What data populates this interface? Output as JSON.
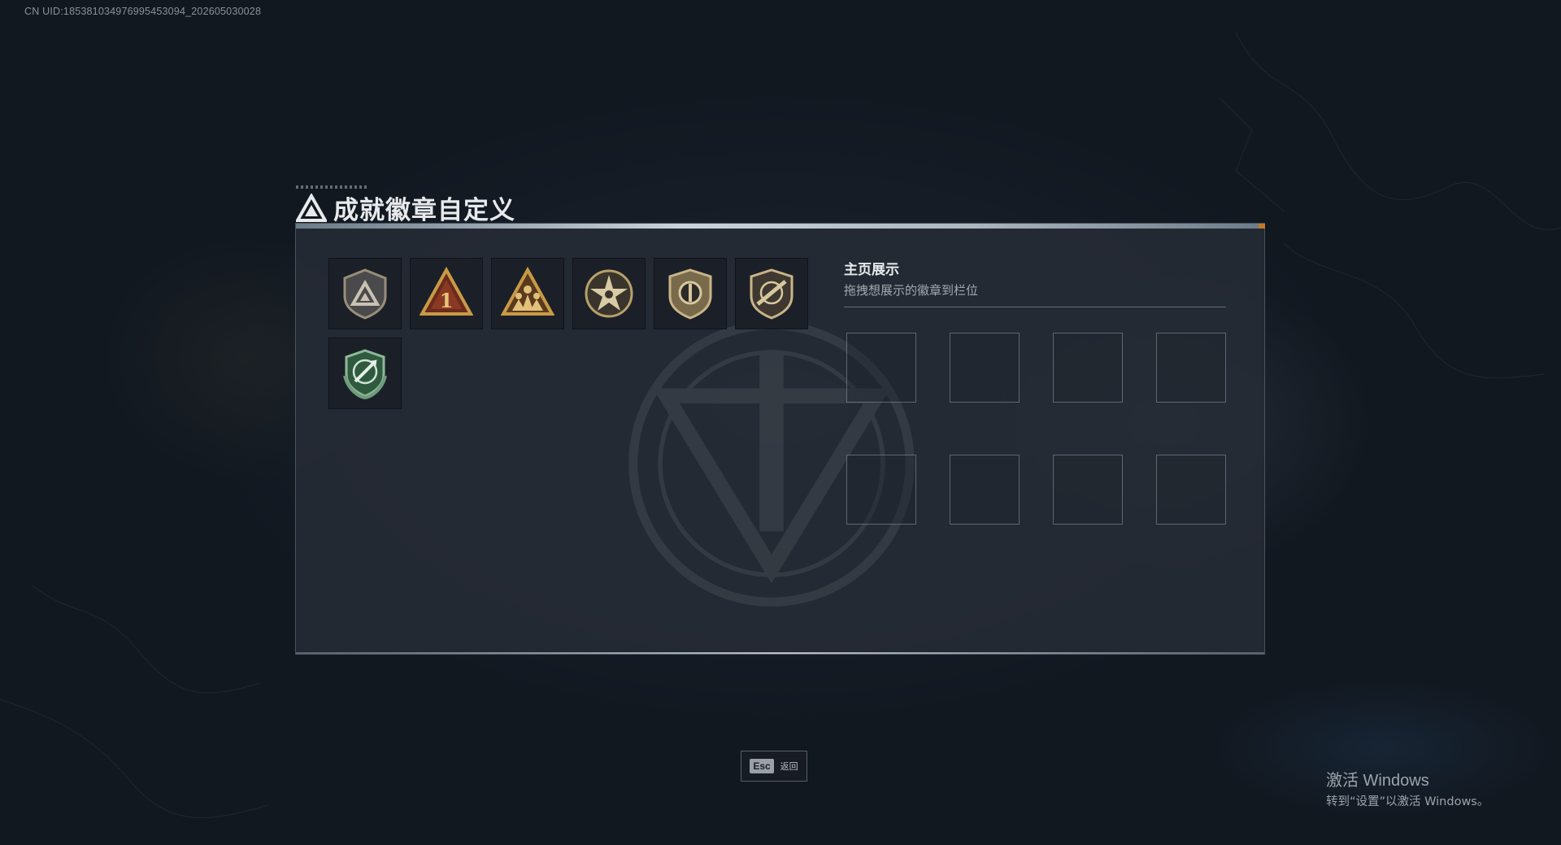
{
  "uid_text": "CN UID:1853810349769954530​94_202605030028",
  "header": {
    "title": "成就徽章自定义",
    "logo_icon": "triangle-logo-icon"
  },
  "badges": [
    {
      "name": "triangle-shield-badge",
      "color": "#8a7a62"
    },
    {
      "name": "triangle-number-one-badge",
      "color": "#b08a3a"
    },
    {
      "name": "triangle-soldiers-badge",
      "color": "#b08a3a"
    },
    {
      "name": "star-wreath-badge",
      "color": "#a89060"
    },
    {
      "name": "shield-emblem-badge",
      "color": "#a89060"
    },
    {
      "name": "shield-rifle-badge",
      "color": "#a89060"
    },
    {
      "name": "green-wreath-crossed-badge",
      "color": "#3d6a4c"
    }
  ],
  "showcase": {
    "title": "主页展示",
    "subtitle": "拖拽想展示的徽章到栏位",
    "slot_count": 8
  },
  "footer": {
    "esc_key": "Esc",
    "esc_label": "返回"
  },
  "os_watermark": {
    "title": "激活 Windows",
    "subtitle": "转到“设置”以激活 Windows。"
  }
}
